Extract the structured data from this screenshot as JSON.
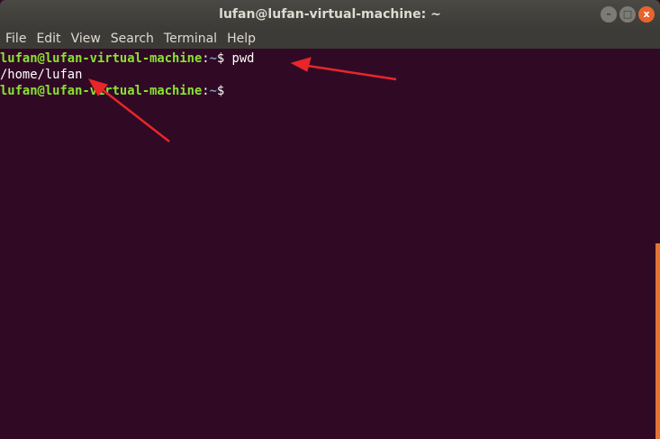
{
  "window": {
    "title": "lufan@lufan-virtual-machine: ~",
    "buttons": [
      "–",
      "□",
      "x"
    ]
  },
  "menu": [
    "File",
    "Edit",
    "View",
    "Search",
    "Terminal",
    "Help"
  ],
  "terminal": {
    "lines": [
      {
        "user": "lufan@lufan-virtual-machine",
        "sep": ":",
        "path": "~",
        "prompt": "$ ",
        "cmd": "pwd"
      },
      {
        "output": "/home/lufan"
      },
      {
        "user": "lufan@lufan-virtual-machine",
        "sep": ":",
        "path": "~",
        "prompt": "$",
        "cmd": ""
      }
    ]
  },
  "colors": {
    "background": "#300a24",
    "prompt_user": "#8ae234",
    "prompt_path": "#729fcf",
    "annotation": "#e8262a"
  }
}
